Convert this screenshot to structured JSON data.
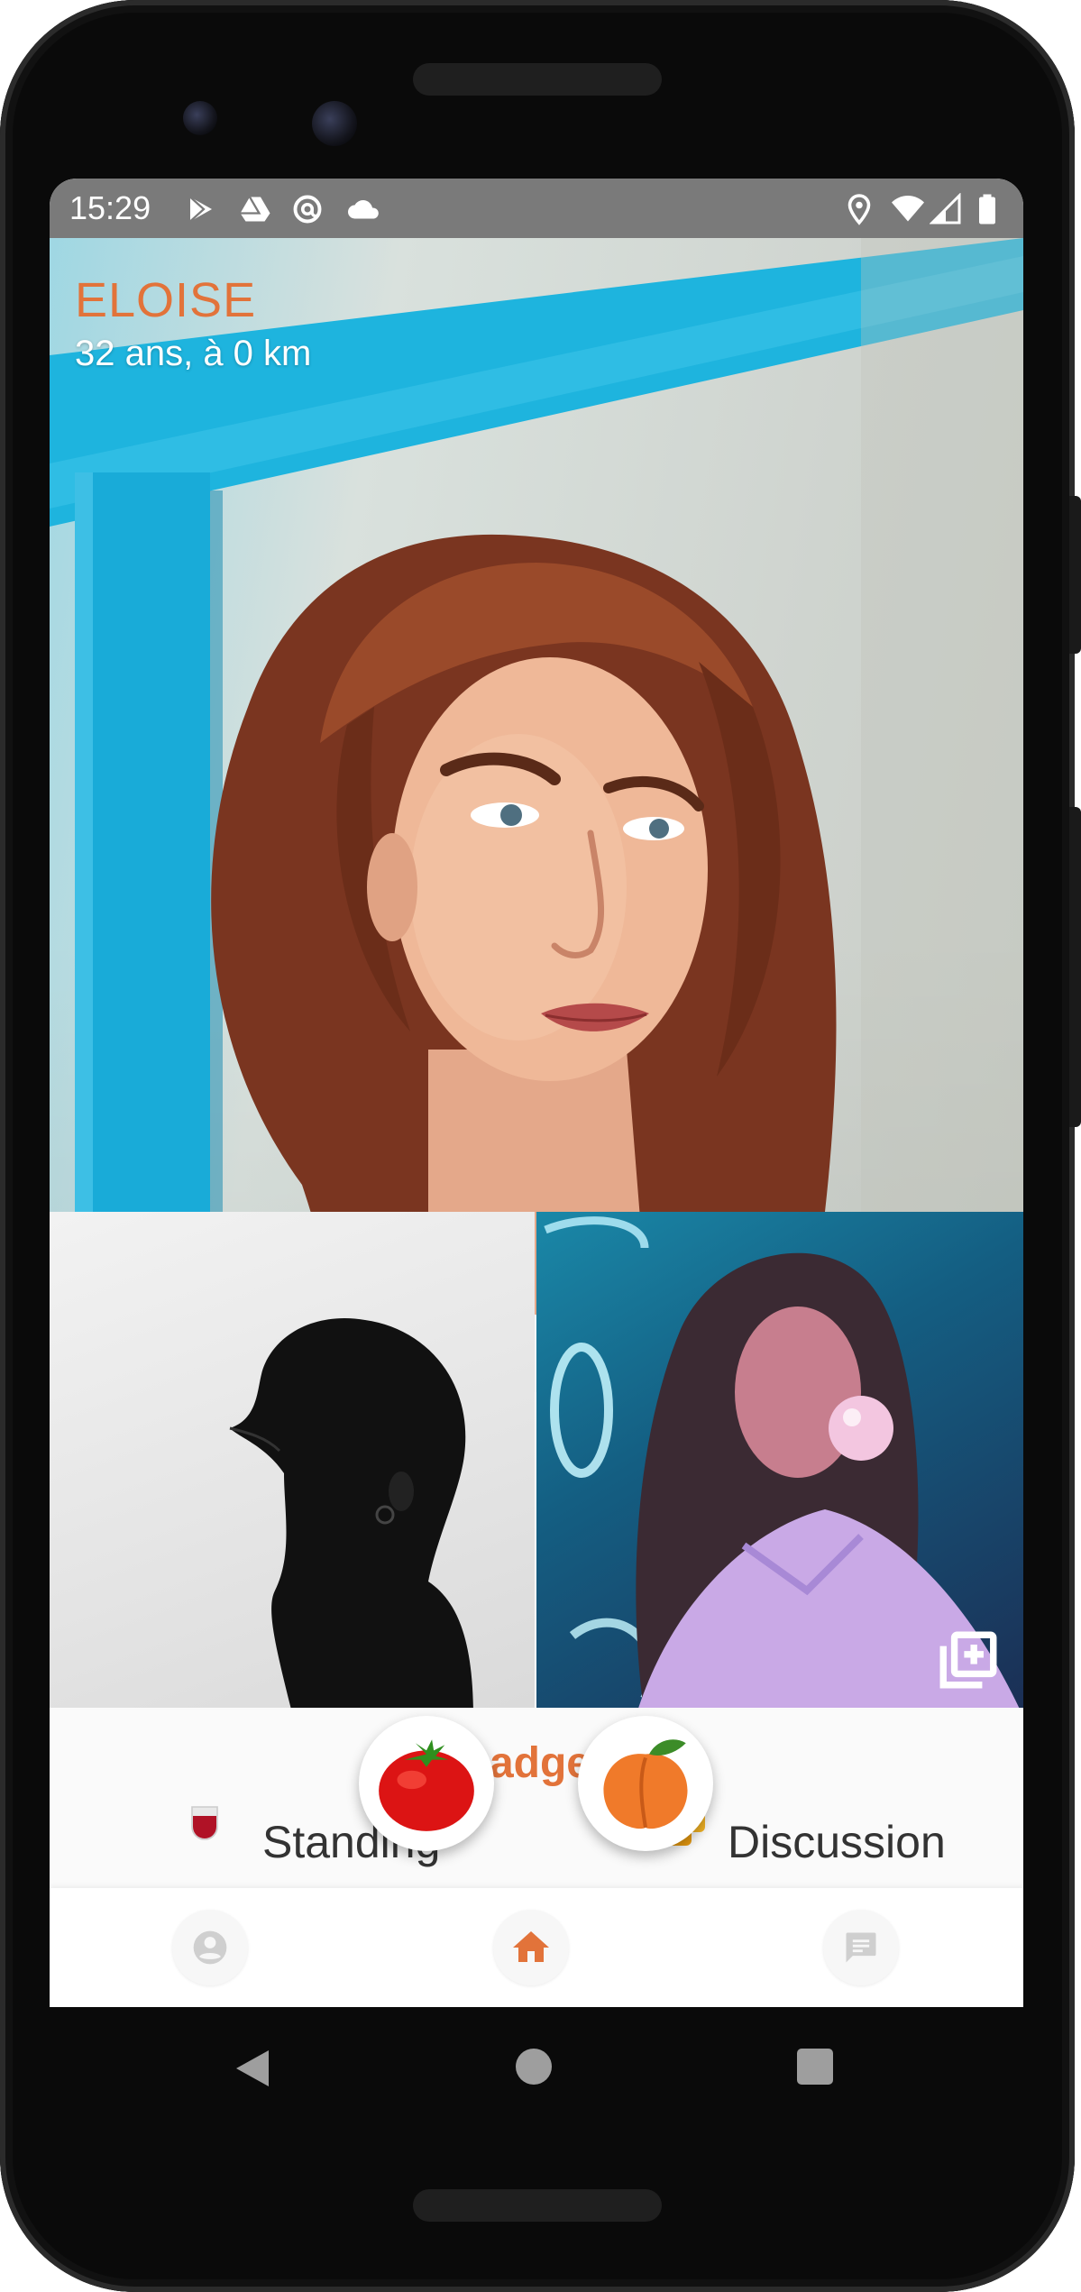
{
  "status_bar": {
    "time": "15:29",
    "left_icons": [
      "play-store-icon",
      "drive-icon",
      "at-sign-icon",
      "cloud-icon"
    ],
    "right_icons": [
      "location-icon",
      "wifi-icon",
      "signal-icon",
      "battery-icon"
    ]
  },
  "profile": {
    "name": "ELOISE",
    "subtitle": "32 ans, à 0 km",
    "accent_color": "#e2733a"
  },
  "photos": {
    "add_photo_icon": "add-photos-icon"
  },
  "badges": {
    "title": "Badges",
    "items": [
      {
        "label": "Standing",
        "icon": "wine-glass-icon"
      },
      {
        "label": "Discussion",
        "icon": "chat-bubble-icon"
      }
    ]
  },
  "actions": {
    "tomato_icon": "tomato-icon",
    "peach_icon": "peach-icon"
  },
  "bottom_nav": {
    "items": [
      {
        "icon": "account-icon",
        "active": false
      },
      {
        "icon": "home-icon",
        "active": true
      },
      {
        "icon": "chat-icon",
        "active": false
      }
    ]
  },
  "system_nav": [
    "back-icon",
    "home-circle-icon",
    "recents-icon"
  ]
}
